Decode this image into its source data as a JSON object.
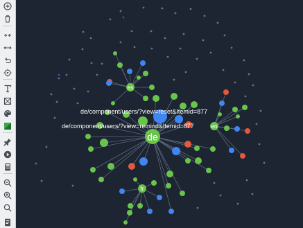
{
  "colors": {
    "background": "#1d2432",
    "toolbar_bg": "#eef0f2",
    "icon": "#4a4f57",
    "edge": "#5c6a7c",
    "node_green": "#6ac44b",
    "node_blue": "#3f86f2",
    "node_red": "#e4583b",
    "node_grey": "#6c7482",
    "node_dark_blue": "#2f55b8",
    "label": "#ffffff"
  },
  "toolbar": {
    "tools": [
      {
        "icon": "zoom-add-icon",
        "label": "Add"
      },
      {
        "icon": "trash-icon",
        "label": "Delete"
      },
      {
        "icon": "collapse-arrows-icon",
        "label": "Collapse"
      },
      {
        "icon": "expand-arrows-icon",
        "label": "Expand"
      },
      {
        "icon": "undo-icon",
        "label": "Undo"
      },
      {
        "icon": "target-icon",
        "label": "Focus"
      },
      {
        "icon": "text-icon",
        "label": "Text"
      },
      {
        "icon": "crop-icon",
        "label": "Select area"
      },
      {
        "icon": "palette-icon",
        "label": "Colors"
      },
      {
        "icon": "contrast-icon",
        "label": "Theme"
      },
      {
        "icon": "pin-icon",
        "label": "Pin"
      },
      {
        "icon": "play-icon",
        "label": "Play"
      },
      {
        "icon": "calculator-icon",
        "label": "Calculator"
      },
      {
        "icon": "zoom-out-icon",
        "label": "Zoom out"
      },
      {
        "icon": "zoom-in-icon",
        "label": "Zoom in"
      },
      {
        "icon": "zoom-reset-icon",
        "label": "Zoom reset"
      },
      {
        "icon": "document-icon",
        "label": "Document"
      }
    ]
  },
  "graph": {
    "hub_labels": {
      "de": "de",
      "es": "es",
      "en": "en",
      "fr": "fr"
    },
    "url_labels": [
      "de/component/users/?view=reset&Itemid=877",
      "de/component/users/?view=remind&Itemid=877"
    ]
  }
}
